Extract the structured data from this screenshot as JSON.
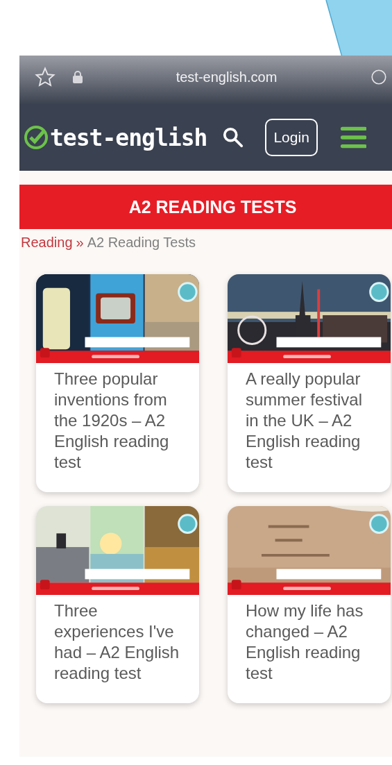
{
  "browser": {
    "url": "test-english.com"
  },
  "header": {
    "logo": "test-english",
    "login_button": "Login"
  },
  "banner": {
    "title": "A2 READING TESTS"
  },
  "breadcrumb": {
    "link": "Reading",
    "separator": "»",
    "current": "A2 Reading Tests"
  },
  "cards": [
    {
      "title": "Three popular inventions from the 1920s – A2 English reading test"
    },
    {
      "title": "A really popular summer festival in the UK – A2 English reading test"
    },
    {
      "title": "Three experiences I've had – A2 English reading test"
    },
    {
      "title": "How my life has changed – A2 English reading test"
    }
  ]
}
